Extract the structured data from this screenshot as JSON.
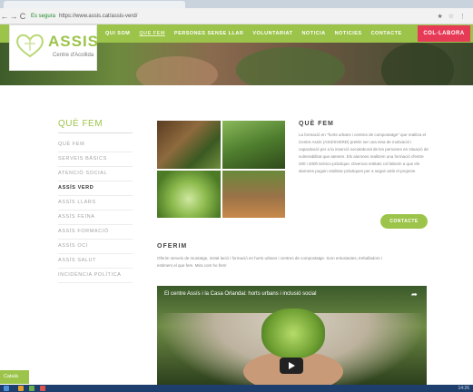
{
  "browser": {
    "secure_label": "Es segura",
    "url": "https://www.assis.cat/assis-verd/",
    "back_icon": "back-arrow-icon",
    "forward_icon": "forward-arrow-icon",
    "reload_icon": "reload-icon",
    "ext_icons": "★ ☆ ⋮"
  },
  "site": {
    "logo_brand": "ASSIS",
    "logo_sub": "Centre d'Acollida",
    "menu": [
      "QUI SOM",
      "QUE FEM",
      "PERSONES SENSE LLAR",
      "VOLUNTARIAT",
      "NOTICIA",
      "NOTICIES",
      "CONTACTE"
    ],
    "cta": "COL·LABORA",
    "accent": "#9cc44a",
    "cta_color": "#e73a56"
  },
  "sidebar": {
    "title": "QUÈ FEM",
    "items": [
      "QUÈ FEM",
      "SERVEIS BÀSICS",
      "ATENCIÓ SOCIAL",
      "ASSÍS VERD",
      "ASSÍS LLARS",
      "ASSÍS FEINA",
      "ASSÍS FORMACIÓ",
      "ASSÍS OCI",
      "ASSÍS SALUT",
      "INCIDÈNCIA POLÍTICA"
    ],
    "current": "ASSÍS VERD"
  },
  "main": {
    "heading": "QUÈ FEM",
    "paragraph": "La formació en \"horts urbans i centres de compostatge\" que realitza el Centre Assís (ASSÍSVERD) pretén ser una eina de motivació i capacitació per a la inserció sociolaboral de les persones en situació de vulnerabilitat que atenem. Els alumnes realitzen una formació d'entre 200 i 400h teòrico-pràctique. Diversos entitats col·laborin a que els alumnes puguin realitzar pràctiques per a seguir amb el projecte.",
    "contact_button": "CONTACTE",
    "offer_heading": "OFERIM",
    "offer_text": "Oferim serveis de muntatge, instal·lació i formació en horts urbans i centres de compostatge. Som entusiastes, treballadors i estimem el que fem. Mira com ho fem!",
    "video_title": "El centre Assís i la Casa Orlandai: horts urbans i inclusió social",
    "share_icon": "share-arrow-icon",
    "play_icon": "play-icon"
  },
  "language": "Català",
  "taskbar": {
    "time": "14:26"
  }
}
